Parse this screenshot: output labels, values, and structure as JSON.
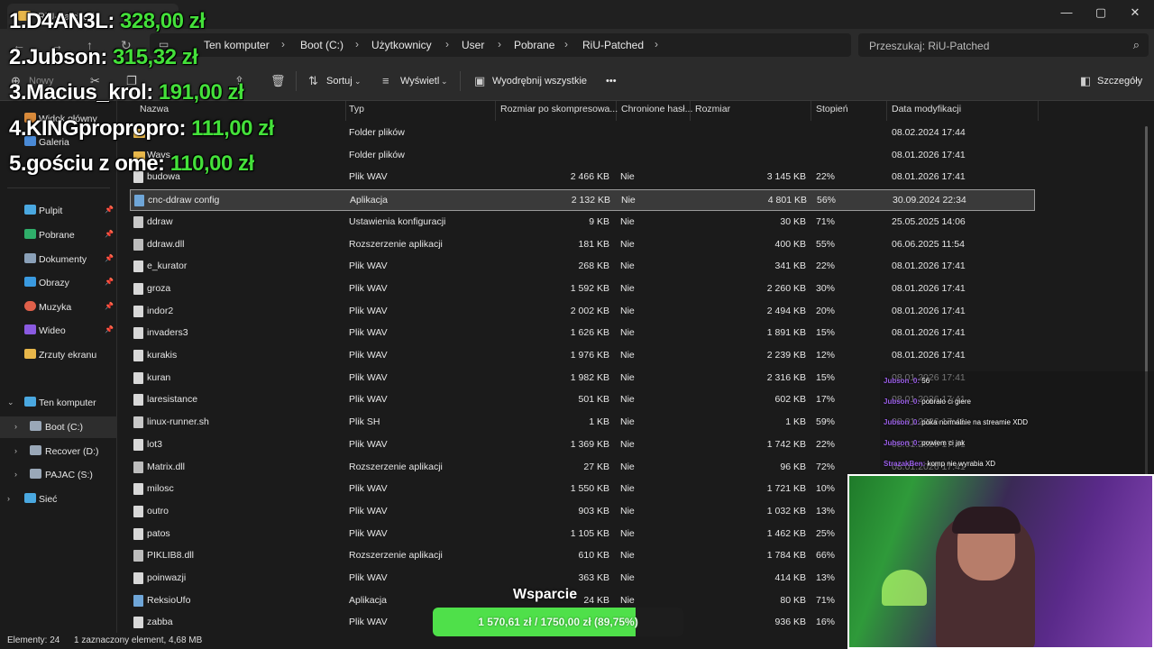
{
  "window": {
    "tab_title": "RiU-Patched",
    "controls": [
      "—",
      "▢",
      "✕"
    ]
  },
  "address": {
    "crumbs": [
      "Ten komputer",
      "Boot (C:)",
      "Użytkownicy",
      "User",
      "Pobrane",
      "RiU-Patched"
    ],
    "search_placeholder": "Przeszukaj: RiU-Patched"
  },
  "toolbar": {
    "new_label": "Nowy",
    "sort_label": "Sortuj",
    "view_label": "Wyświetl",
    "extract_label": "Wyodrębnij wszystkie",
    "more_label": "•••",
    "details_label": "Szczegóły"
  },
  "sidebar": {
    "items": [
      {
        "label": "Widok główny",
        "icon": "home-icon"
      },
      {
        "label": "Galeria",
        "icon": "gallery-icon"
      },
      {
        "label": "Pulpit",
        "icon": "desktop-icon"
      },
      {
        "label": "Pobrane",
        "icon": "download-icon"
      },
      {
        "label": "Dokumenty",
        "icon": "documents-icon"
      },
      {
        "label": "Obrazy",
        "icon": "pictures-icon"
      },
      {
        "label": "Muzyka",
        "icon": "music-icon"
      },
      {
        "label": "Wideo",
        "icon": "video-icon"
      },
      {
        "label": "Zrzuty ekranu",
        "icon": "folder-icon"
      },
      {
        "label": "Ten komputer",
        "icon": "computer-icon"
      },
      {
        "label": "Boot (C:)",
        "icon": "drive-icon"
      },
      {
        "label": "Recover (D:)",
        "icon": "drive-icon"
      },
      {
        "label": "PAJAC (S:)",
        "icon": "drive-icon"
      },
      {
        "label": "Sieć",
        "icon": "network-icon"
      }
    ]
  },
  "columns": [
    "Nazwa",
    "Typ",
    "Rozmiar po skompresowa...",
    "Chronione hasł...",
    "Rozmiar",
    "Stopień",
    "Data modyfikacji"
  ],
  "files": [
    {
      "name": "",
      "type": "Folder plików",
      "csize": "",
      "prot": "",
      "size": "",
      "ratio": "",
      "date": "08.02.2024 17:44",
      "icon": "folder"
    },
    {
      "name": "Wavs",
      "type": "Folder plików",
      "csize": "",
      "prot": "",
      "size": "",
      "ratio": "",
      "date": "08.01.2026 17:41",
      "icon": "folder"
    },
    {
      "name": "budowa",
      "type": "Plik WAV",
      "csize": "2 466 KB",
      "prot": "Nie",
      "size": "3 145 KB",
      "ratio": "22%",
      "date": "08.01.2026 17:41",
      "icon": "wav"
    },
    {
      "name": "cnc-ddraw config",
      "type": "Aplikacja",
      "csize": "2 132 KB",
      "prot": "Nie",
      "size": "4 801 KB",
      "ratio": "56%",
      "date": "30.09.2024 22:34",
      "icon": "app"
    },
    {
      "name": "ddraw",
      "type": "Ustawienia konfiguracji",
      "csize": "9 KB",
      "prot": "Nie",
      "size": "30 KB",
      "ratio": "71%",
      "date": "25.05.2025 14:06",
      "icon": "cfg"
    },
    {
      "name": "ddraw.dll",
      "type": "Rozszerzenie aplikacji",
      "csize": "181 KB",
      "prot": "Nie",
      "size": "400 KB",
      "ratio": "55%",
      "date": "06.06.2025 11:54",
      "icon": "dll"
    },
    {
      "name": "e_kurator",
      "type": "Plik WAV",
      "csize": "268 KB",
      "prot": "Nie",
      "size": "341 KB",
      "ratio": "22%",
      "date": "08.01.2026 17:41",
      "icon": "wav"
    },
    {
      "name": "groza",
      "type": "Plik WAV",
      "csize": "1 592 KB",
      "prot": "Nie",
      "size": "2 260 KB",
      "ratio": "30%",
      "date": "08.01.2026 17:41",
      "icon": "wav"
    },
    {
      "name": "indor2",
      "type": "Plik WAV",
      "csize": "2 002 KB",
      "prot": "Nie",
      "size": "2 494 KB",
      "ratio": "20%",
      "date": "08.01.2026 17:41",
      "icon": "wav"
    },
    {
      "name": "invaders3",
      "type": "Plik WAV",
      "csize": "1 626 KB",
      "prot": "Nie",
      "size": "1 891 KB",
      "ratio": "15%",
      "date": "08.01.2026 17:41",
      "icon": "wav"
    },
    {
      "name": "kurakis",
      "type": "Plik WAV",
      "csize": "1 976 KB",
      "prot": "Nie",
      "size": "2 239 KB",
      "ratio": "12%",
      "date": "08.01.2026 17:41",
      "icon": "wav"
    },
    {
      "name": "kuran",
      "type": "Plik WAV",
      "csize": "1 982 KB",
      "prot": "Nie",
      "size": "2 316 KB",
      "ratio": "15%",
      "date": "08.01.2026 17:41",
      "icon": "wav"
    },
    {
      "name": "laresistance",
      "type": "Plik WAV",
      "csize": "501 KB",
      "prot": "Nie",
      "size": "602 KB",
      "ratio": "17%",
      "date": "08.01.2026 17:41",
      "icon": "wav"
    },
    {
      "name": "linux-runner.sh",
      "type": "Plik SH",
      "csize": "1 KB",
      "prot": "Nie",
      "size": "1 KB",
      "ratio": "59%",
      "date": "08.01.2026 17:41",
      "icon": "cfg"
    },
    {
      "name": "lot3",
      "type": "Plik WAV",
      "csize": "1 369 KB",
      "prot": "Nie",
      "size": "1 742 KB",
      "ratio": "22%",
      "date": "08.01.2026 17:41",
      "icon": "wav"
    },
    {
      "name": "Matrix.dll",
      "type": "Rozszerzenie aplikacji",
      "csize": "27 KB",
      "prot": "Nie",
      "size": "96 KB",
      "ratio": "72%",
      "date": "08.01.2026 17:41",
      "icon": "dll"
    },
    {
      "name": "milosc",
      "type": "Plik WAV",
      "csize": "1 550 KB",
      "prot": "Nie",
      "size": "1 721 KB",
      "ratio": "10%",
      "date": "08.01.2026 17:41",
      "icon": "wav"
    },
    {
      "name": "outro",
      "type": "Plik WAV",
      "csize": "903 KB",
      "prot": "Nie",
      "size": "1 032 KB",
      "ratio": "13%",
      "date": "08.01.2026 17:41",
      "icon": "wav"
    },
    {
      "name": "patos",
      "type": "Plik WAV",
      "csize": "1 105 KB",
      "prot": "Nie",
      "size": "1 462 KB",
      "ratio": "25%",
      "date": "08.01.2026 17:41",
      "icon": "wav"
    },
    {
      "name": "PIKLIB8.dll",
      "type": "Rozszerzenie aplikacji",
      "csize": "610 KB",
      "prot": "Nie",
      "size": "1 784 KB",
      "ratio": "66%",
      "date": "08.01.2026 17:41",
      "icon": "dll"
    },
    {
      "name": "poinwazji",
      "type": "Plik WAV",
      "csize": "363 KB",
      "prot": "Nie",
      "size": "414 KB",
      "ratio": "13%",
      "date": "08.01.2026 17:41",
      "icon": "wav"
    },
    {
      "name": "ReksioUfo",
      "type": "Aplikacja",
      "csize": "24 KB",
      "prot": "Nie",
      "size": "80 KB",
      "ratio": "71%",
      "date": "08.01.2026 17:41",
      "icon": "app"
    },
    {
      "name": "zabba",
      "type": "Plik WAV",
      "csize": "",
      "prot": "",
      "size": "936 KB",
      "ratio": "16%",
      "date": "08.01.2026 17:41",
      "icon": "wav"
    }
  ],
  "status": {
    "count": "Elementy: 24",
    "selection": "1 zaznaczony element, 4,68 MB"
  },
  "leaderboard": [
    {
      "rank": "1.D4AN3L:",
      "amount": "328,00 zł"
    },
    {
      "rank": "2.Jubson:",
      "amount": "315,32 zł"
    },
    {
      "rank": "3.Macius_krol:",
      "amount": "191,00 zł"
    },
    {
      "rank": "4.KINGpropropro:",
      "amount": "111,00 zł"
    },
    {
      "rank": "5.gościu z ome:",
      "amount": "110,00 zł"
    }
  ],
  "chat": [
    {
      "user": "Jubson_0:",
      "msg": "56"
    },
    {
      "user": "Jubson_0:",
      "msg": "pobrało ci giere"
    },
    {
      "user": "Jubson_0:",
      "msg": "póka normalnie na streamie XDD"
    },
    {
      "user": "Jubson_0:",
      "msg": "powiem ci jak"
    },
    {
      "user": "StrazakBen:",
      "msg": "komp nie wyrabia XD"
    }
  ],
  "goal": {
    "title": "Wsparcie",
    "text": "1 570,61 zł / 1750,00 zł (89,75%)",
    "fraction": 0.8975
  }
}
